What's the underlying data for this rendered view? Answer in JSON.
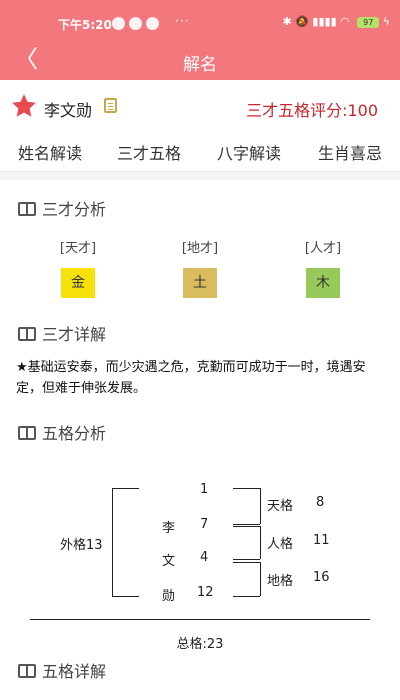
{
  "status_bar": {
    "time": "下午5:20",
    "more": "···",
    "battery": "97"
  },
  "header": {
    "title": "解名"
  },
  "profile": {
    "name": "李文勋",
    "score_text": "三才五格评分:100"
  },
  "tabs": [
    {
      "label": "姓名解读"
    },
    {
      "label": "三才五格"
    },
    {
      "label": "八字解读"
    },
    {
      "label": "生肖喜忌"
    }
  ],
  "active_tab": 1,
  "sections": {
    "sancai_analysis": "三才分析",
    "sancai_detail": "三才详解",
    "wuge_analysis": "五格分析",
    "wuge_detail": "五格详解"
  },
  "sancai": [
    {
      "label": "[天才]",
      "element": "金",
      "color": "#f6e20a"
    },
    {
      "label": "[地才]",
      "element": "土",
      "color": "#d9bc5e"
    },
    {
      "label": "[人才]",
      "element": "木",
      "color": "#96c95a"
    }
  ],
  "sancai_description": "★基础运安泰，而少灾遇之危，克勤而可成功于一时，境遇安定，但难于伸张发展。",
  "wuge": {
    "top_number": "1",
    "chars": [
      {
        "char": "李",
        "stroke": "7"
      },
      {
        "char": "文",
        "stroke": "4"
      },
      {
        "char": "勋",
        "stroke": "12"
      }
    ],
    "outer": "外格13",
    "grids": [
      {
        "name": "天格",
        "value": "8"
      },
      {
        "name": "人格",
        "value": "11"
      },
      {
        "name": "地格",
        "value": "16"
      }
    ],
    "total": "总格:23"
  }
}
